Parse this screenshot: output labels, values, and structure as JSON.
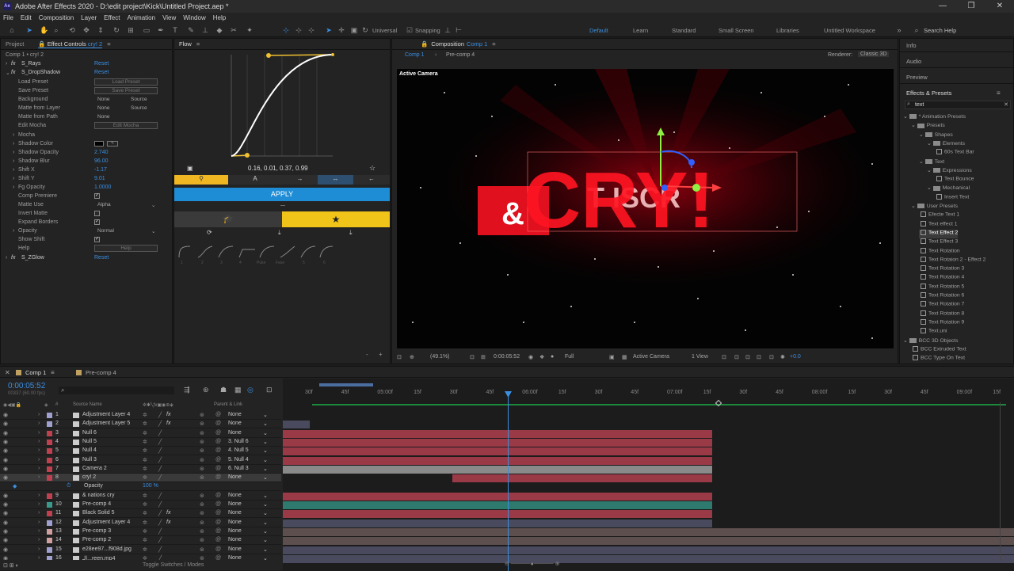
{
  "app": {
    "title": "Adobe After Effects 2020 - D:\\edit project\\Kick\\Untitled Project.aep *",
    "icon": "Ae"
  },
  "window_controls": [
    "—",
    "❐",
    "✕"
  ],
  "menu": [
    "File",
    "Edit",
    "Composition",
    "Layer",
    "Effect",
    "Animation",
    "View",
    "Window",
    "Help"
  ],
  "toolbar": {
    "universal": "Universal",
    "snapping": "Snapping",
    "workspaces": [
      "Default",
      "Learn",
      "Standard",
      "Small Screen",
      "Libraries",
      "Untitled Workspace"
    ],
    "search_help": "Search Help"
  },
  "left_tabs": {
    "project": "Project",
    "effect_controls": "Effect Controls",
    "layer_ref": "cry! 2",
    "path": "Comp 1 • cry! 2"
  },
  "effects": {
    "s_rays": {
      "name": "S_Rays",
      "reset": "Reset"
    },
    "s_dropshadow": {
      "name": "S_DropShadow",
      "reset": "Reset"
    },
    "load_preset": {
      "label": "Load Preset",
      "btn": "Load Preset"
    },
    "save_preset": {
      "label": "Save Preset",
      "btn": "Save Preset"
    },
    "background": {
      "label": "Background",
      "v1": "None",
      "v2": "Source"
    },
    "matte_from_layer": {
      "label": "Matte from Layer",
      "v1": "None",
      "v2": "Source"
    },
    "matte_from_path": {
      "label": "Matte from Path",
      "v1": "None"
    },
    "edit_mocha": {
      "label": "Edit Mocha",
      "btn": "Edit Mocha"
    },
    "mocha": {
      "label": "Mocha"
    },
    "shadow_color": {
      "label": "Shadow Color"
    },
    "shadow_opacity": {
      "label": "Shadow Opacity",
      "value": "2.740"
    },
    "shadow_blur": {
      "label": "Shadow Blur",
      "value": "96.00"
    },
    "shift_x": {
      "label": "Shift X",
      "value": "-1.17"
    },
    "shift_y": {
      "label": "Shift Y",
      "value": "9.01"
    },
    "fg_opacity": {
      "label": "Fg Opacity",
      "value": "1.0000"
    },
    "comp_premiere": {
      "label": "Comp Premiere"
    },
    "matte_use": {
      "label": "Matte Use",
      "value": "Alpha"
    },
    "invert_matte": {
      "label": "Invert Matte"
    },
    "expand_borders": {
      "label": "Expand Borders"
    },
    "opacity": {
      "label": "Opacity",
      "value": "Normal"
    },
    "show_shift": {
      "label": "Show Shift"
    },
    "help": {
      "label": "Help",
      "btn": "Help"
    },
    "s_zglow": {
      "name": "S_ZGlow",
      "reset": "Reset"
    }
  },
  "flow": {
    "tab": "Flow",
    "values": "0.16, 0.01, 0.37, 0.99",
    "apply": "APPLY",
    "preset_labels": [
      "1",
      "2",
      "3",
      "4",
      "Puke",
      "Fase",
      "5",
      "6"
    ]
  },
  "composition": {
    "tab": "Composition",
    "comp_name": "Comp 1",
    "sub_tabs": [
      "Comp 1",
      "Pre-comp 4"
    ],
    "renderer_label": "Renderer:",
    "renderer": "Classic 3D",
    "active_camera": "Active Camera",
    "zoom": "(49.1%)",
    "timecode": "0:00:05:52",
    "quality": "Full",
    "view": "Active Camera",
    "views": "1 View",
    "exposure": "+0.0",
    "title_text": "CRY!",
    "amp": "&",
    "small_text": "T ISCR"
  },
  "right_panel": {
    "info": "Info",
    "audio": "Audio",
    "preview": "Preview",
    "effects_presets": "Effects & Presets",
    "search": "text",
    "tree": [
      {
        "indent": 0,
        "label": "* Animation Presets",
        "type": "folder"
      },
      {
        "indent": 1,
        "label": "Presets",
        "type": "folder"
      },
      {
        "indent": 2,
        "label": "Shapes",
        "type": "folder"
      },
      {
        "indent": 3,
        "label": "Elements",
        "type": "folder"
      },
      {
        "indent": 4,
        "label": "60s Text Bar",
        "type": "preset"
      },
      {
        "indent": 2,
        "label": "Text",
        "type": "folder"
      },
      {
        "indent": 3,
        "label": "Expressions",
        "type": "folder"
      },
      {
        "indent": 4,
        "label": "Text Bounce",
        "type": "preset"
      },
      {
        "indent": 3,
        "label": "Mechanical",
        "type": "folder"
      },
      {
        "indent": 4,
        "label": "Insert Text",
        "type": "preset"
      },
      {
        "indent": 1,
        "label": "User Presets",
        "type": "folder"
      },
      {
        "indent": 2,
        "label": "Efecte Text 1",
        "type": "preset"
      },
      {
        "indent": 2,
        "label": "Text effect 1",
        "type": "preset"
      },
      {
        "indent": 2,
        "label": "Text Effect 2",
        "type": "preset",
        "selected": true
      },
      {
        "indent": 2,
        "label": "Text Effect 3",
        "type": "preset"
      },
      {
        "indent": 2,
        "label": "Text Rotation",
        "type": "preset"
      },
      {
        "indent": 2,
        "label": "Text Rotaion 2 - Effect 2",
        "type": "preset"
      },
      {
        "indent": 2,
        "label": "Text Rotation 3",
        "type": "preset"
      },
      {
        "indent": 2,
        "label": "Text Rotation 4",
        "type": "preset"
      },
      {
        "indent": 2,
        "label": "Text Rotation 5",
        "type": "preset"
      },
      {
        "indent": 2,
        "label": "Text Rotation 6",
        "type": "preset"
      },
      {
        "indent": 2,
        "label": "Text Rotation 7",
        "type": "preset"
      },
      {
        "indent": 2,
        "label": "Text Rotation 8",
        "type": "preset"
      },
      {
        "indent": 2,
        "label": "Text Rotation 9",
        "type": "preset"
      },
      {
        "indent": 2,
        "label": "Text.uni",
        "type": "preset"
      },
      {
        "indent": 0,
        "label": "BCC 3D Objects",
        "type": "folder"
      },
      {
        "indent": 1,
        "label": "BCC Extruded Text",
        "type": "preset"
      },
      {
        "indent": 1,
        "label": "BCC Type On Text",
        "type": "preset"
      }
    ]
  },
  "timeline": {
    "tabs": [
      "Comp 1",
      "Pre-comp 4"
    ],
    "timecode": "0:00:05:52",
    "fps": "00337 (60.00 fps)",
    "col_source": "Source Name",
    "col_parent": "Parent & Link",
    "toggle": "Toggle Switches / Modes",
    "ruler": [
      "30f",
      "45f",
      "05:00f",
      "15f",
      "30f",
      "45f",
      "06:00f",
      "15f",
      "30f",
      "45f",
      "07:00f",
      "15f",
      "30f",
      "45f",
      "08:00f",
      "15f",
      "30f",
      "45f",
      "09:00f",
      "15f"
    ],
    "layers": [
      {
        "num": "1",
        "name": "Adjustment Layer 4",
        "color": "#a0a0d0",
        "parent": "None",
        "fx": true
      },
      {
        "num": "2",
        "name": "Adjustment Layer 5",
        "color": "#a0a0d0",
        "parent": "None",
        "fx": true
      },
      {
        "num": "3",
        "name": "Null 6",
        "color": "#c04050",
        "parent": "None"
      },
      {
        "num": "4",
        "name": "Null 5",
        "color": "#c04050",
        "parent": "3. Null 6"
      },
      {
        "num": "5",
        "name": "Null 4",
        "color": "#c04050",
        "parent": "4. Null 5"
      },
      {
        "num": "6",
        "name": "Null 3",
        "color": "#c04050",
        "parent": "5. Null 4"
      },
      {
        "num": "7",
        "name": "Camera 2",
        "color": "#c04050",
        "parent": "6. Null 3"
      },
      {
        "num": "8",
        "name": "cry! 2",
        "color": "#c04050",
        "parent": "None",
        "selected": true
      },
      {
        "num": "",
        "name": "Opacity",
        "color": "",
        "parent": "",
        "sub": true,
        "value": "100 %"
      },
      {
        "num": "9",
        "name": "& nations cry",
        "color": "#c04050",
        "parent": "None"
      },
      {
        "num": "10",
        "name": "Pre-comp 4",
        "color": "#3a9a8a",
        "parent": "None"
      },
      {
        "num": "11",
        "name": "Black Solid 5",
        "color": "#c04050",
        "parent": "None",
        "fx": true
      },
      {
        "num": "12",
        "name": "Adjustment Layer 4",
        "color": "#a0a0d0",
        "parent": "None",
        "fx": true
      },
      {
        "num": "13",
        "name": "Pre-comp 3",
        "color": "#d0a0a0",
        "parent": "None"
      },
      {
        "num": "14",
        "name": "Pre-comp 2",
        "color": "#d0a0a0",
        "parent": "None"
      },
      {
        "num": "15",
        "name": "e28ee97...f908d.jpg",
        "color": "#a0a0d0",
        "parent": "None"
      },
      {
        "num": "16",
        "name": "الـ...reen.mp4",
        "color": "#a0a0d0",
        "parent": "None"
      }
    ]
  }
}
